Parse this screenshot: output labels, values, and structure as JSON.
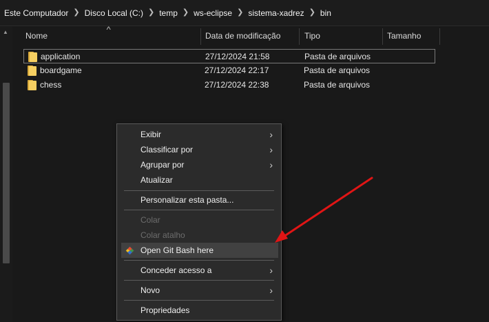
{
  "breadcrumbs": [
    "Este Computador",
    "Disco Local (C:)",
    "temp",
    "ws-eclipse",
    "sistema-xadrez",
    "bin"
  ],
  "columns": {
    "name": "Nome",
    "modified": "Data de modificação",
    "type": "Tipo",
    "size": "Tamanho"
  },
  "files": [
    {
      "name": "application",
      "modified": "27/12/2024 21:58",
      "type": "Pasta de arquivos",
      "icon": "folder-icon",
      "selected": true
    },
    {
      "name": "boardgame",
      "modified": "27/12/2024 22:17",
      "type": "Pasta de arquivos",
      "icon": "folder-icon",
      "selected": false
    },
    {
      "name": "chess",
      "modified": "27/12/2024 22:38",
      "type": "Pasta de arquivos",
      "icon": "folder-icon",
      "selected": false
    }
  ],
  "context_menu": {
    "items": [
      {
        "label": "Exibir",
        "submenu": true,
        "enabled": true
      },
      {
        "label": "Classificar por",
        "submenu": true,
        "enabled": true
      },
      {
        "label": "Agrupar por",
        "submenu": true,
        "enabled": true
      },
      {
        "label": "Atualizar",
        "submenu": false,
        "enabled": true
      },
      {
        "label": "Personalizar esta pasta...",
        "submenu": false,
        "enabled": true
      },
      {
        "label": "Colar",
        "submenu": false,
        "enabled": false
      },
      {
        "label": "Colar atalho",
        "submenu": false,
        "enabled": false
      },
      {
        "label": "Open Git Bash here",
        "submenu": false,
        "enabled": true,
        "highlighted": true,
        "icon": "git-icon"
      },
      {
        "label": "Conceder acesso a",
        "submenu": true,
        "enabled": true
      },
      {
        "label": "Novo",
        "submenu": true,
        "enabled": true
      },
      {
        "label": "Propriedades",
        "submenu": false,
        "enabled": true
      }
    ]
  },
  "icons": {
    "breadcrumb_separator": "chevron-right-icon",
    "sort": "sort-up-icon",
    "submenu": "chevron-right-icon"
  },
  "colors": {
    "background": "#191919",
    "menu_background": "#2b2b2b",
    "annotation_arrow": "#e01515",
    "folder": "#f6cf61"
  }
}
